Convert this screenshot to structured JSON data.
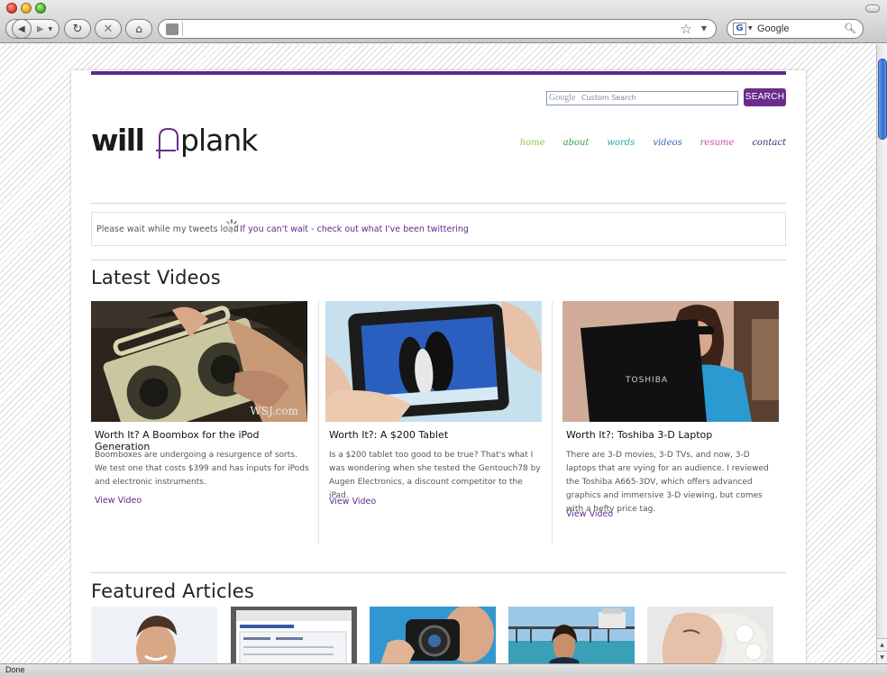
{
  "browser": {
    "search_placeholder": "Google",
    "status": "Done"
  },
  "search": {
    "placeholder": "Custom Search",
    "brand": "Google",
    "button": "SEARCH"
  },
  "nav": [
    {
      "label": "home",
      "color": "#8cc63f"
    },
    {
      "label": "about",
      "color": "#3aa04a"
    },
    {
      "label": "words",
      "color": "#2aa6a0"
    },
    {
      "label": "videos",
      "color": "#3b67b5"
    },
    {
      "label": "resume",
      "color": "#c4509a"
    },
    {
      "label": "contact",
      "color": "#4a2a7a"
    }
  ],
  "tweets": {
    "loading": "Please wait while my tweets load",
    "link": "If you can't wait - check out what I've been twittering"
  },
  "videos_section": {
    "title": "Latest Videos",
    "items": [
      {
        "title": "Worth It? A Boombox for the iPod Generation",
        "description": "Boomboxes are undergoing a resurgence of sorts. We test one that costs $399 and has inputs for iPods and electronic instruments.",
        "link": "View Video",
        "watermark": "WSJ.com"
      },
      {
        "title": "Worth It?: A $200 Tablet",
        "description": "Is a $200 tablet too good to be true? That's what I was wondering when she tested the Gentouch78 by Augen Electronics, a discount competitor to the iPad.",
        "link": "View Video"
      },
      {
        "title": "Worth It?: Toshiba 3-D Laptop",
        "description": "There are 3-D movies, 3-D TVs, and now, 3-D laptops that are vying for an audience. I reviewed the Toshiba A665-3DV, which offers advanced graphics and immersive 3-D viewing, but comes with a hefty price tag.",
        "link": "View Video",
        "laptop_brand": "TOSHIBA"
      }
    ]
  },
  "articles_section": {
    "title": "Featured Articles"
  },
  "colors": {
    "accent": "#5e2b8a",
    "search_button": "#6a2d8c"
  }
}
